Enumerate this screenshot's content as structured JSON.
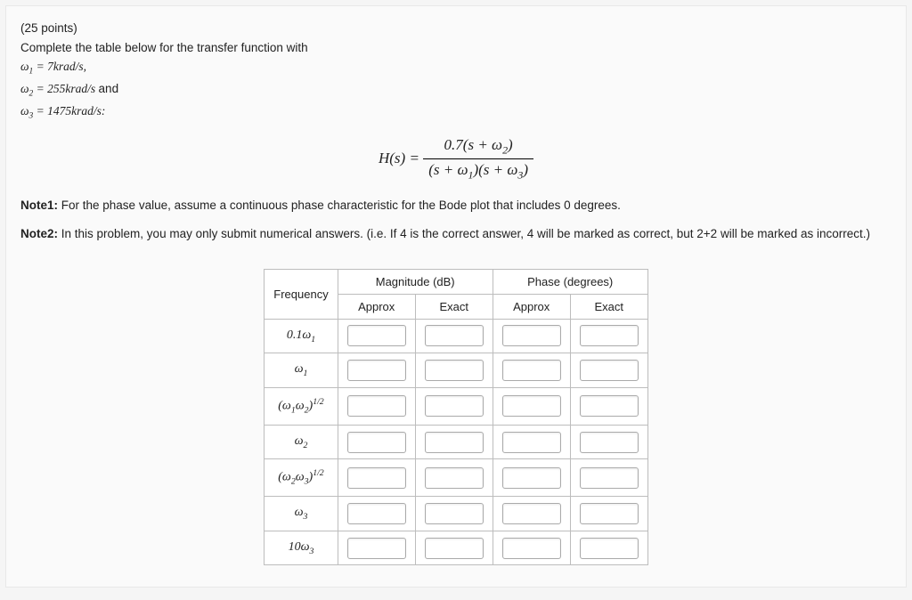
{
  "header": {
    "points": "(25 points)",
    "prompt": "Complete the table below for the transfer function with",
    "w1_def": "ω₁ = 7krad/s,",
    "w2_def": "ω₂ = 255krad/s and",
    "w3_def": "ω₃ = 1475krad/s:"
  },
  "equation": {
    "lhs": "H(s) =",
    "numerator": "0.7(s + ω₂)",
    "denominator": "(s + ω₁)(s + ω₃)"
  },
  "notes": {
    "note1_label": "Note1:",
    "note1_text": " For the phase value, assume a continuous phase characteristic for the Bode plot that includes 0 degrees.",
    "note2_label": "Note2:",
    "note2_text": " In this problem, you may only submit numerical answers. (i.e. If 4 is the correct answer, 4 will be marked as correct, but 2+2 will be marked as incorrect.)"
  },
  "table": {
    "col_freq": "Frequency",
    "col_mag": "Magnitude (dB)",
    "col_phase": "Phase (degrees)",
    "sub_approx": "Approx",
    "sub_exact": "Exact",
    "rows": [
      {
        "label": "0.1ω₁"
      },
      {
        "label": "ω₁"
      },
      {
        "label": "(ω₁ω₂)¹ᐟ²"
      },
      {
        "label": "ω₂"
      },
      {
        "label": "(ω₂ω₃)¹ᐟ²"
      },
      {
        "label": "ω₃"
      },
      {
        "label": "10ω₃"
      }
    ]
  },
  "chart_data": {
    "type": "table",
    "columns": [
      "Frequency",
      "Magnitude (dB) Approx",
      "Magnitude (dB) Exact",
      "Phase (degrees) Approx",
      "Phase (degrees) Exact"
    ],
    "rows": [
      [
        "0.1ω₁",
        "",
        "",
        "",
        ""
      ],
      [
        "ω₁",
        "",
        "",
        "",
        ""
      ],
      [
        "(ω₁ω₂)^1/2",
        "",
        "",
        "",
        ""
      ],
      [
        "ω₂",
        "",
        "",
        "",
        ""
      ],
      [
        "(ω₂ω₃)^1/2",
        "",
        "",
        "",
        ""
      ],
      [
        "ω₃",
        "",
        "",
        "",
        ""
      ],
      [
        "10ω₃",
        "",
        "",
        "",
        ""
      ]
    ]
  }
}
